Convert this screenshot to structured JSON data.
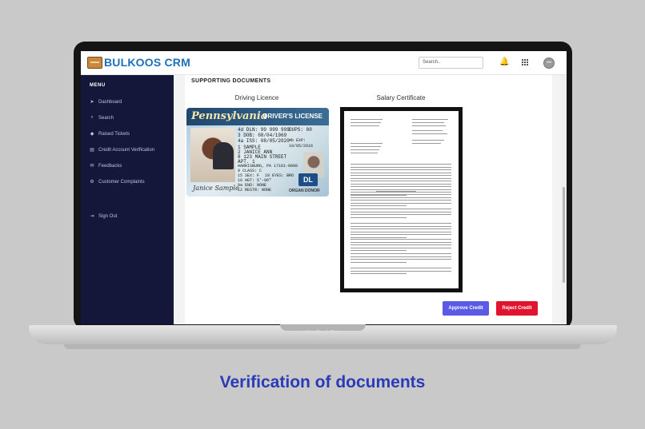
{
  "app": {
    "name": "BULKOOS CRM"
  },
  "header": {
    "search_placeholder": "Search.."
  },
  "sidebar": {
    "menu_title": "MENU",
    "items": [
      {
        "label": "Dashboard",
        "icon": "rocket-icon"
      },
      {
        "label": "Search",
        "icon": "search-icon"
      },
      {
        "label": "Raised Tickets",
        "icon": "ticket-icon"
      },
      {
        "label": "Credit Account Verification",
        "icon": "document-icon"
      },
      {
        "label": "Feedbacks",
        "icon": "mail-icon"
      },
      {
        "label": "Customer Complaints",
        "icon": "complaint-icon"
      },
      {
        "label": "Sign Out",
        "icon": "signout-icon"
      }
    ]
  },
  "main": {
    "section_title": "SUPPORTING  DOCUMENTS",
    "documents": [
      {
        "label": "Driving Licence"
      },
      {
        "label": "Salary Certificate"
      }
    ],
    "license": {
      "state": "Pennsylvania",
      "type": "DRIVER'S LICENSE",
      "dl_no": "4d DLN: 99 999 999",
      "dups": "DUPS: 00",
      "dob": "3 DOB: 08/04/1969",
      "iss": "4a ISS: 08/05/2020",
      "exp": "4b EXP: 10/05/2016",
      "name1": "1 SAMPLE",
      "name2": "2 JANICE ANN",
      "addr1": "8 123 MAIN STREET",
      "addr2": "APT. 1",
      "addr3": "HARRISBURG, PA 17101-0000",
      "class": "9 CLASS: C",
      "sex": "15 SEX: F",
      "eyes": "18 EYES: BRO",
      "hgt": "16 HGT: 5'-06\"",
      "end": "9a END: NONE",
      "rstr": "12 RESTR: NONE",
      "signature": "Janice Sample",
      "badge": "DL",
      "organ": "ORGAN DONOR"
    },
    "buttons": {
      "approve": "Approve Credit",
      "reject": "Reject Credit"
    }
  },
  "device": {
    "label": "MacBook Pro"
  },
  "caption": "Verification of documents"
}
